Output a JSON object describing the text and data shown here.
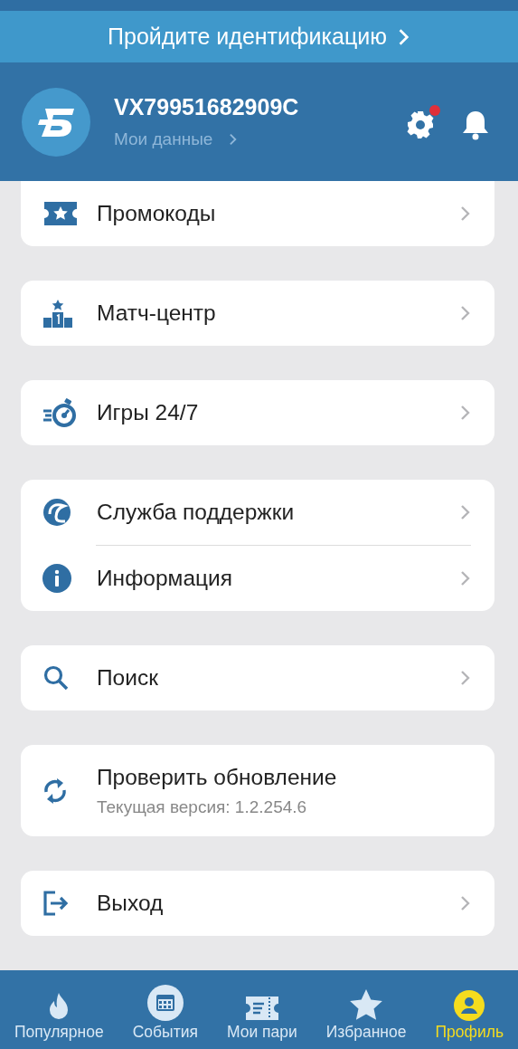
{
  "banner": {
    "text": "Пройдите идентификацию"
  },
  "profile": {
    "username": "VX79951682909C",
    "link": "Мои данные",
    "settings_badge": true
  },
  "groups": [
    {
      "items": [
        {
          "label": "Промокоды"
        }
      ]
    },
    {
      "items": [
        {
          "label": "Матч-центр"
        }
      ]
    },
    {
      "items": [
        {
          "label": "Игры 24/7"
        }
      ]
    },
    {
      "items": [
        {
          "label": "Служба поддержки"
        },
        {
          "label": "Информация"
        }
      ]
    },
    {
      "items": [
        {
          "label": "Поиск"
        }
      ]
    },
    {
      "items": [
        {
          "label": "Проверить обновление",
          "subtitle": "Текущая версия: 1.2.254.6"
        }
      ]
    },
    {
      "items": [
        {
          "label": "Выход"
        }
      ]
    }
  ],
  "nav": [
    {
      "label": "Популярное",
      "selected": false
    },
    {
      "label": "События",
      "selected": false
    },
    {
      "label": "Мои пари",
      "selected": false
    },
    {
      "label": "Избранное",
      "selected": false
    },
    {
      "label": "Профиль",
      "selected": true
    }
  ]
}
